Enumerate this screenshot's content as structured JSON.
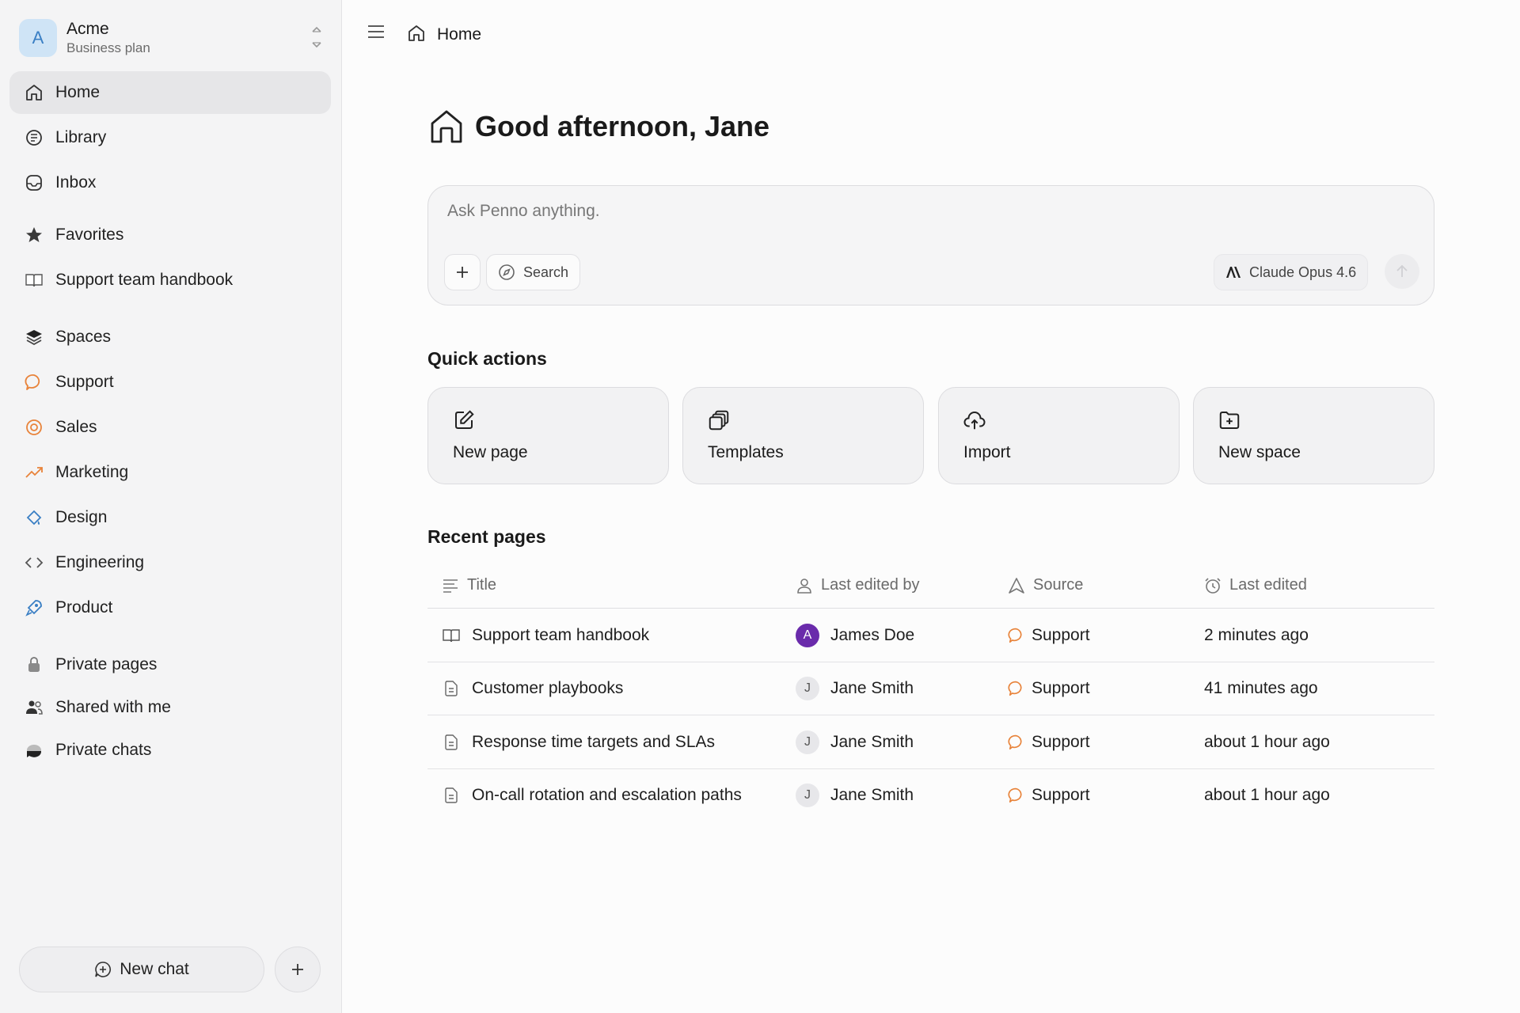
{
  "workspace": {
    "avatar_letter": "A",
    "name": "Acme",
    "plan": "Business plan"
  },
  "sidebar": {
    "items": [
      {
        "label": "Home",
        "icon": "home-icon"
      },
      {
        "label": "Library",
        "icon": "library-icon"
      },
      {
        "label": "Inbox",
        "icon": "inbox-icon"
      },
      {
        "label": "Favorites",
        "icon": "star-icon"
      },
      {
        "label": "Support team handbook",
        "icon": "book-icon"
      },
      {
        "label": "Spaces",
        "icon": "layers-icon"
      },
      {
        "label": "Support",
        "icon": "chat-bubble-icon"
      },
      {
        "label": "Sales",
        "icon": "target-icon"
      },
      {
        "label": "Marketing",
        "icon": "trend-up-icon"
      },
      {
        "label": "Design",
        "icon": "paint-icon"
      },
      {
        "label": "Engineering",
        "icon": "code-icon"
      },
      {
        "label": "Product",
        "icon": "rocket-icon"
      },
      {
        "label": "Private pages",
        "icon": "lock-icon"
      },
      {
        "label": "Shared with me",
        "icon": "users-icon"
      },
      {
        "label": "Private chats",
        "icon": "chat-private-icon"
      }
    ],
    "new_chat_label": "New chat"
  },
  "topbar": {
    "breadcrumb": "Home"
  },
  "main": {
    "greeting": "Good afternoon, Jane",
    "composer": {
      "placeholder": "Ask Penno anything.",
      "search_label": "Search",
      "model_label": "Claude Opus 4.6"
    },
    "quick_actions_title": "Quick actions",
    "quick_actions": [
      {
        "label": "New page",
        "icon": "edit-icon"
      },
      {
        "label": "Templates",
        "icon": "copy-icon"
      },
      {
        "label": "Import",
        "icon": "cloud-upload-icon"
      },
      {
        "label": "New space",
        "icon": "folder-plus-icon"
      }
    ],
    "recent_title": "Recent pages",
    "columns": {
      "title": "Title",
      "editor": "Last edited by",
      "source": "Source",
      "time": "Last edited"
    },
    "rows": [
      {
        "title": "Support team handbook",
        "editor": "James Doe",
        "editor_initial": "A",
        "source": "Support",
        "time": "2 minutes ago"
      },
      {
        "title": "Customer playbooks",
        "editor": "Jane Smith",
        "editor_initial": "J",
        "source": "Support",
        "time": "41 minutes ago"
      },
      {
        "title": "Response time targets and SLAs",
        "editor": "Jane Smith",
        "editor_initial": "J",
        "source": "Support",
        "time": "about 1 hour ago"
      },
      {
        "title": "On-call rotation and escalation paths",
        "editor": "Jane Smith",
        "editor_initial": "J",
        "source": "Support",
        "time": "about 1 hour ago"
      }
    ]
  },
  "colors": {
    "accent_orange": "#e8833a",
    "accent_blue": "#3a7fc4",
    "avatar_purple": "#6a2bab"
  }
}
